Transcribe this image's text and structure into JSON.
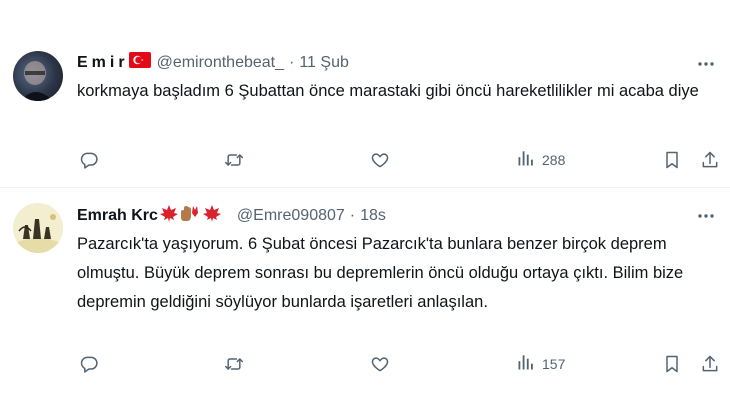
{
  "tweets": [
    {
      "display_name": "Emir",
      "flag_emoji": "🇹🇷",
      "handle": "@emironthebeat_",
      "separator": "·",
      "time": "11 Şub",
      "text": "korkmaya başladım 6 Şubattan önce marastaki gibi öncü hareketlilikler mi acaba diye",
      "views": "288"
    },
    {
      "display_name": "Emrah Krc",
      "name_emojis": "🍁☝🏽🍁",
      "handle": "@Emre090807",
      "separator": "·",
      "time": "18s",
      "text": "Pazarcık'ta yaşıyorum. 6 Şubat öncesi Pazarcık'ta bunlara benzer birçok deprem olmuştu. Büyük deprem sonrası bu depremlerin öncü olduğu ortaya çıktı. Bilim bize depremin geldiğini söylüyor bunlarda işaretleri anlaşılan.",
      "views": "157"
    }
  ],
  "icons": {
    "reply": "reply-icon",
    "retweet": "retweet-icon",
    "like": "heart-icon",
    "views": "views-icon",
    "bookmark": "bookmark-icon",
    "share": "share-icon",
    "more": "more-icon"
  },
  "colors": {
    "text": "#0f1419",
    "secondary": "#536471",
    "divider": "#eff3f4",
    "flag_red": "#e30a17"
  }
}
